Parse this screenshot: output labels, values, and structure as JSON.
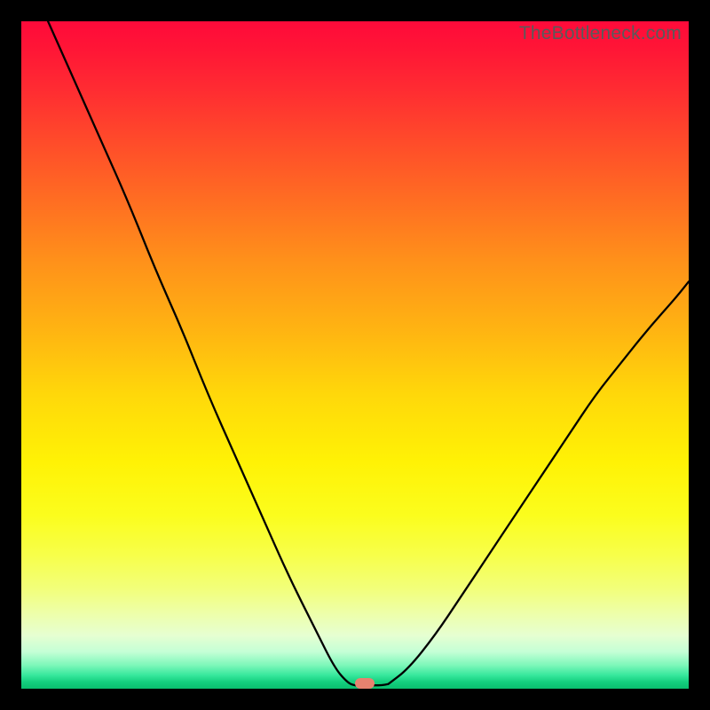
{
  "watermark": "TheBottleneck.com",
  "marker": {
    "x_frac": 0.515,
    "y_frac": 0.992
  },
  "chart_data": {
    "type": "line",
    "title": "",
    "xlabel": "",
    "ylabel": "",
    "xlim": [
      0,
      100
    ],
    "ylim": [
      0,
      100
    ],
    "grid": false,
    "legend": false,
    "series": [
      {
        "name": "left-branch",
        "x": [
          4,
          8,
          12,
          16,
          20,
          24,
          28,
          32,
          36,
          40,
          44,
          47,
          49,
          50
        ],
        "y": [
          100,
          91,
          82,
          73,
          63,
          54,
          44,
          35,
          26,
          17,
          9,
          3,
          0.8,
          0.5
        ]
      },
      {
        "name": "flat-bottom",
        "x": [
          50,
          51,
          52,
          53,
          54,
          55
        ],
        "y": [
          0.5,
          0.5,
          0.5,
          0.5,
          0.5,
          0.7
        ]
      },
      {
        "name": "right-branch",
        "x": [
          55,
          58,
          62,
          66,
          70,
          74,
          78,
          82,
          86,
          90,
          94,
          98,
          100
        ],
        "y": [
          0.7,
          3,
          8,
          14,
          20,
          26,
          32,
          38,
          44,
          49,
          54,
          58.5,
          61
        ]
      }
    ],
    "annotations": [
      {
        "text": "TheBottleneck.com",
        "position": "top-right"
      }
    ]
  }
}
